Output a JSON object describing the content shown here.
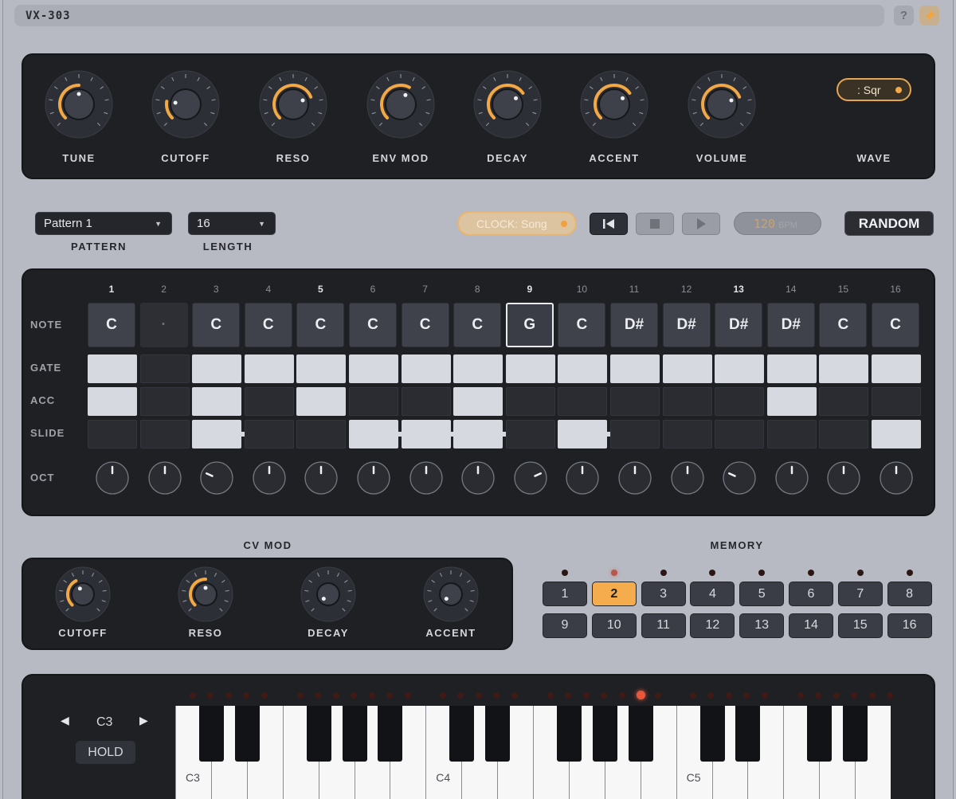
{
  "window": {
    "title": "VX-303",
    "help_label": "?",
    "pin_icon": "pin-icon"
  },
  "synth": {
    "knobs": [
      {
        "label": "TUNE",
        "value": 0.5
      },
      {
        "label": "CUTOFF",
        "value": 0.2
      },
      {
        "label": "RESO",
        "value": 0.75
      },
      {
        "label": "ENV MOD",
        "value": 0.6
      },
      {
        "label": "DECAY",
        "value": 0.7
      },
      {
        "label": "ACCENT",
        "value": 0.7
      },
      {
        "label": "VOLUME",
        "value": 0.75
      }
    ],
    "wave_label": "WAVE",
    "wave_value": ": Sqr"
  },
  "sequencer_controls": {
    "pattern_value": "Pattern 1",
    "pattern_label": "PATTERN",
    "length_value": "16",
    "length_label": "LENGTH",
    "clock_value": "CLOCK: Song",
    "bpm_value": "120",
    "bpm_unit": "BPM",
    "random_label": "RANDOM"
  },
  "steps": {
    "numbers": [
      "1",
      "2",
      "3",
      "4",
      "5",
      "6",
      "7",
      "8",
      "9",
      "10",
      "11",
      "12",
      "13",
      "14",
      "15",
      "16"
    ],
    "bold_numbers": [
      1,
      5,
      9,
      13
    ],
    "row_labels": {
      "note": "NOTE",
      "gate": "GATE",
      "acc": "ACC",
      "slide": "SLIDE",
      "oct": "OCT"
    },
    "notes": [
      "C",
      "·",
      "C",
      "C",
      "C",
      "C",
      "C",
      "C",
      "G",
      "C",
      "D#",
      "D#",
      "D#",
      "D#",
      "C",
      "C"
    ],
    "selected_step": 9,
    "gate": [
      1,
      0,
      1,
      1,
      1,
      1,
      1,
      1,
      1,
      1,
      1,
      1,
      1,
      1,
      1,
      1
    ],
    "acc": [
      1,
      0,
      1,
      0,
      1,
      0,
      0,
      1,
      0,
      0,
      0,
      0,
      0,
      1,
      0,
      0
    ],
    "slide": [
      0,
      0,
      1,
      0,
      0,
      1,
      1,
      1,
      0,
      1,
      0,
      0,
      0,
      0,
      0,
      1
    ],
    "oct": [
      0,
      0,
      -1,
      0,
      0,
      0,
      0,
      0,
      1,
      0,
      0,
      0,
      -1,
      0,
      0,
      0
    ]
  },
  "cv_mod": {
    "title": "CV MOD",
    "knobs": [
      {
        "label": "CUTOFF",
        "value": 0.4
      },
      {
        "label": "RESO",
        "value": 0.5
      },
      {
        "label": "DECAY",
        "value": 0.0
      },
      {
        "label": "ACCENT",
        "value": 0.0
      }
    ]
  },
  "memory": {
    "title": "MEMORY",
    "slots": [
      "1",
      "2",
      "3",
      "4",
      "5",
      "6",
      "7",
      "8",
      "9",
      "10",
      "11",
      "12",
      "13",
      "14",
      "15",
      "16"
    ],
    "active": 2
  },
  "keyboard": {
    "octave": "C3",
    "hold_label": "HOLD",
    "key_labels": [
      "C3",
      "C4",
      "C5"
    ],
    "active_led": 22
  },
  "colors": {
    "accent": "#f2a945",
    "panel": "#1f2024",
    "bg": "#b7bac3"
  }
}
